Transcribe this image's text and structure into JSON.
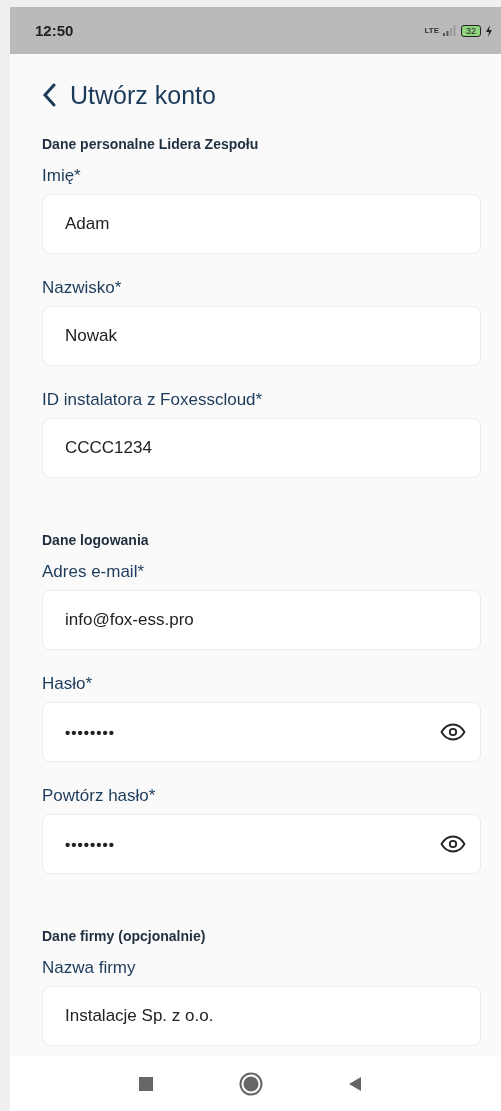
{
  "status_bar": {
    "time": "12:50",
    "network": "LTE",
    "battery": "32"
  },
  "header": {
    "title": "Utwórz konto"
  },
  "sections": [
    {
      "title": "Dane personalne Lidera Zespołu",
      "fields": [
        {
          "kind": "text",
          "label": "Imię*",
          "value": "Adam"
        },
        {
          "kind": "text",
          "label": "Nazwisko*",
          "value": "Nowak"
        },
        {
          "kind": "text",
          "label": "ID instalatora z Foxesscloud*",
          "value": "CCCC1234"
        }
      ]
    },
    {
      "title": "Dane logowania",
      "fields": [
        {
          "kind": "text",
          "label": "Adres e-mail*",
          "value": "info@fox-ess.pro"
        },
        {
          "kind": "password",
          "label": "Hasło*",
          "value": "••••••••"
        },
        {
          "kind": "password",
          "label": "Powtórz hasło*",
          "value": "••••••••"
        }
      ]
    },
    {
      "title": "Dane firmy (opcjonalnie)",
      "fields": [
        {
          "kind": "text",
          "label": "Nazwa firmy",
          "value": "Instalacje Sp. z o.o."
        }
      ]
    }
  ]
}
